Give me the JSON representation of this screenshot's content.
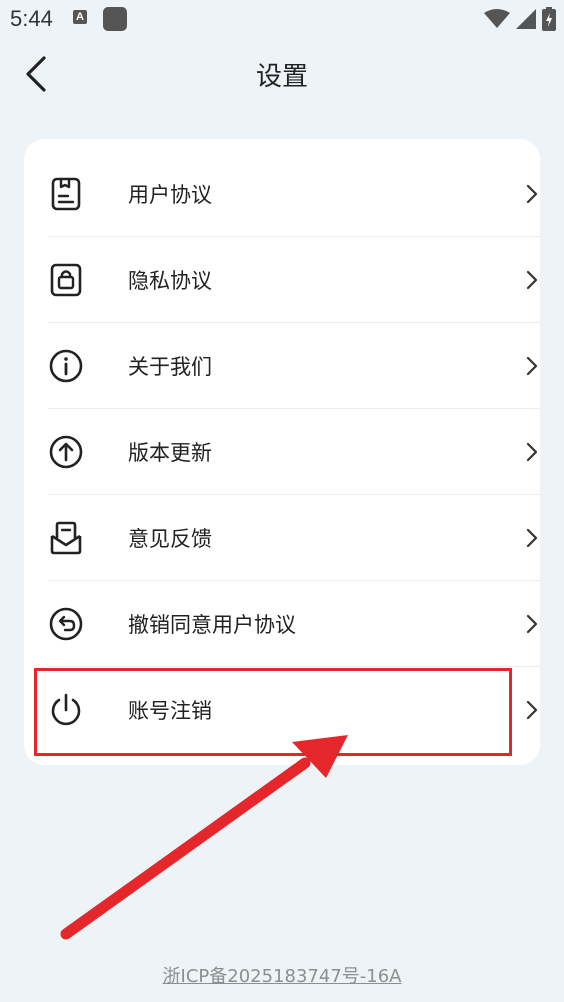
{
  "status_bar": {
    "time": "5:44",
    "notification_badge": "A"
  },
  "header": {
    "title": "设置"
  },
  "menu": {
    "items": [
      {
        "label": "用户协议",
        "icon": "document-icon"
      },
      {
        "label": "隐私协议",
        "icon": "lock-icon"
      },
      {
        "label": "关于我们",
        "icon": "info-icon"
      },
      {
        "label": "版本更新",
        "icon": "upload-arrow-icon"
      },
      {
        "label": "意见反馈",
        "icon": "mail-feedback-icon"
      },
      {
        "label": "撤销同意用户协议",
        "icon": "revoke-icon"
      },
      {
        "label": "账号注销",
        "icon": "power-icon"
      }
    ]
  },
  "footer": {
    "icp": "浙ICP备2025183747号-16A"
  },
  "annotation": {
    "highlight_color": "#e5262b"
  }
}
